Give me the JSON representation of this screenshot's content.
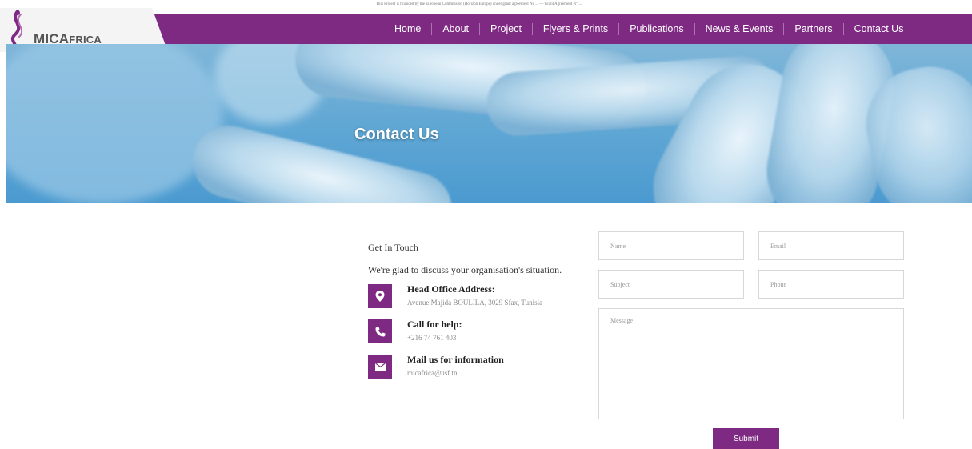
{
  "header": {
    "top_note": "This Project is financed by the European Commission (Horizon Europe) under grant agreement No ... — Grant Agreement N° ...",
    "brand": "MICAfrica",
    "nav": [
      {
        "label": "Home"
      },
      {
        "label": "About"
      },
      {
        "label": "Project"
      },
      {
        "label": "Flyers & Prints"
      },
      {
        "label": "Publications"
      },
      {
        "label": "News & Events"
      },
      {
        "label": "Partners"
      },
      {
        "label": "Contact Us"
      }
    ],
    "accent": "#7e2a83"
  },
  "hero": {
    "title": "Contact Us"
  },
  "contact": {
    "heading": "Get In Touch",
    "subheading": "We're glad to discuss your organisation's situation.",
    "items": [
      {
        "icon": "location-pin-icon",
        "title": "Head Office Address:",
        "text": "Avenue Majida BOULILA, 3029 Sfax, Tunisia"
      },
      {
        "icon": "phone-icon",
        "title": "Call for help:",
        "text": "+216 74 761 403"
      },
      {
        "icon": "envelope-icon",
        "title": "Mail us for information",
        "text": "micafrica@usf.tn"
      }
    ]
  },
  "form": {
    "name_placeholder": "Name",
    "email_placeholder": "Email",
    "subject_placeholder": "Subject",
    "phone_placeholder": "Phone",
    "message_placeholder": "Message",
    "submit_label": "Submit"
  }
}
